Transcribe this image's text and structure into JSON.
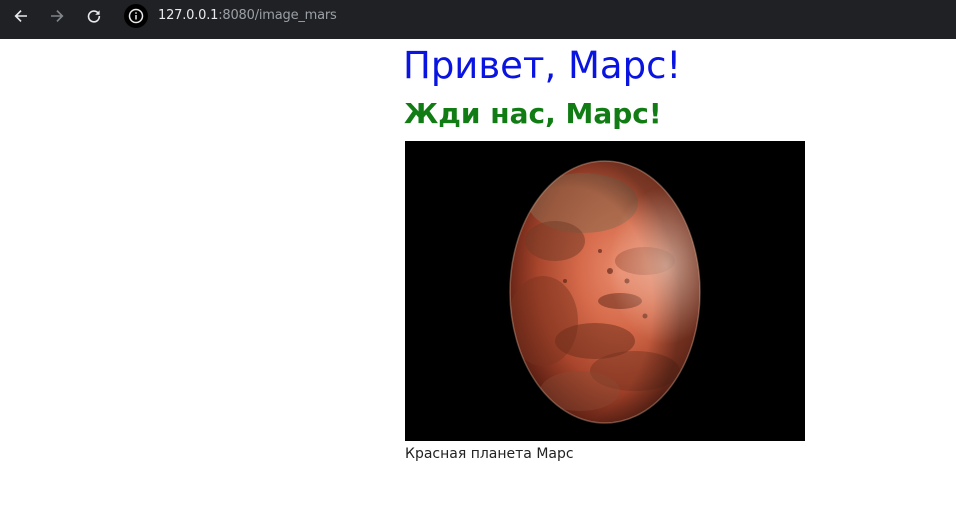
{
  "browser": {
    "back_icon": "arrow-left-icon",
    "forward_icon": "arrow-right-icon",
    "reload_icon": "reload-icon",
    "site_info_icon": "info-icon",
    "url_host": "127.0.0.1",
    "url_rest": ":8080/image_mars"
  },
  "page": {
    "heading": "Привет, Марс!",
    "subheading": "Жди нас, Марс!",
    "image_caption": "Красная планета Марс"
  },
  "colors": {
    "heading": "#0a14e0",
    "subheading": "#127c14",
    "browser_bar": "#202124"
  }
}
